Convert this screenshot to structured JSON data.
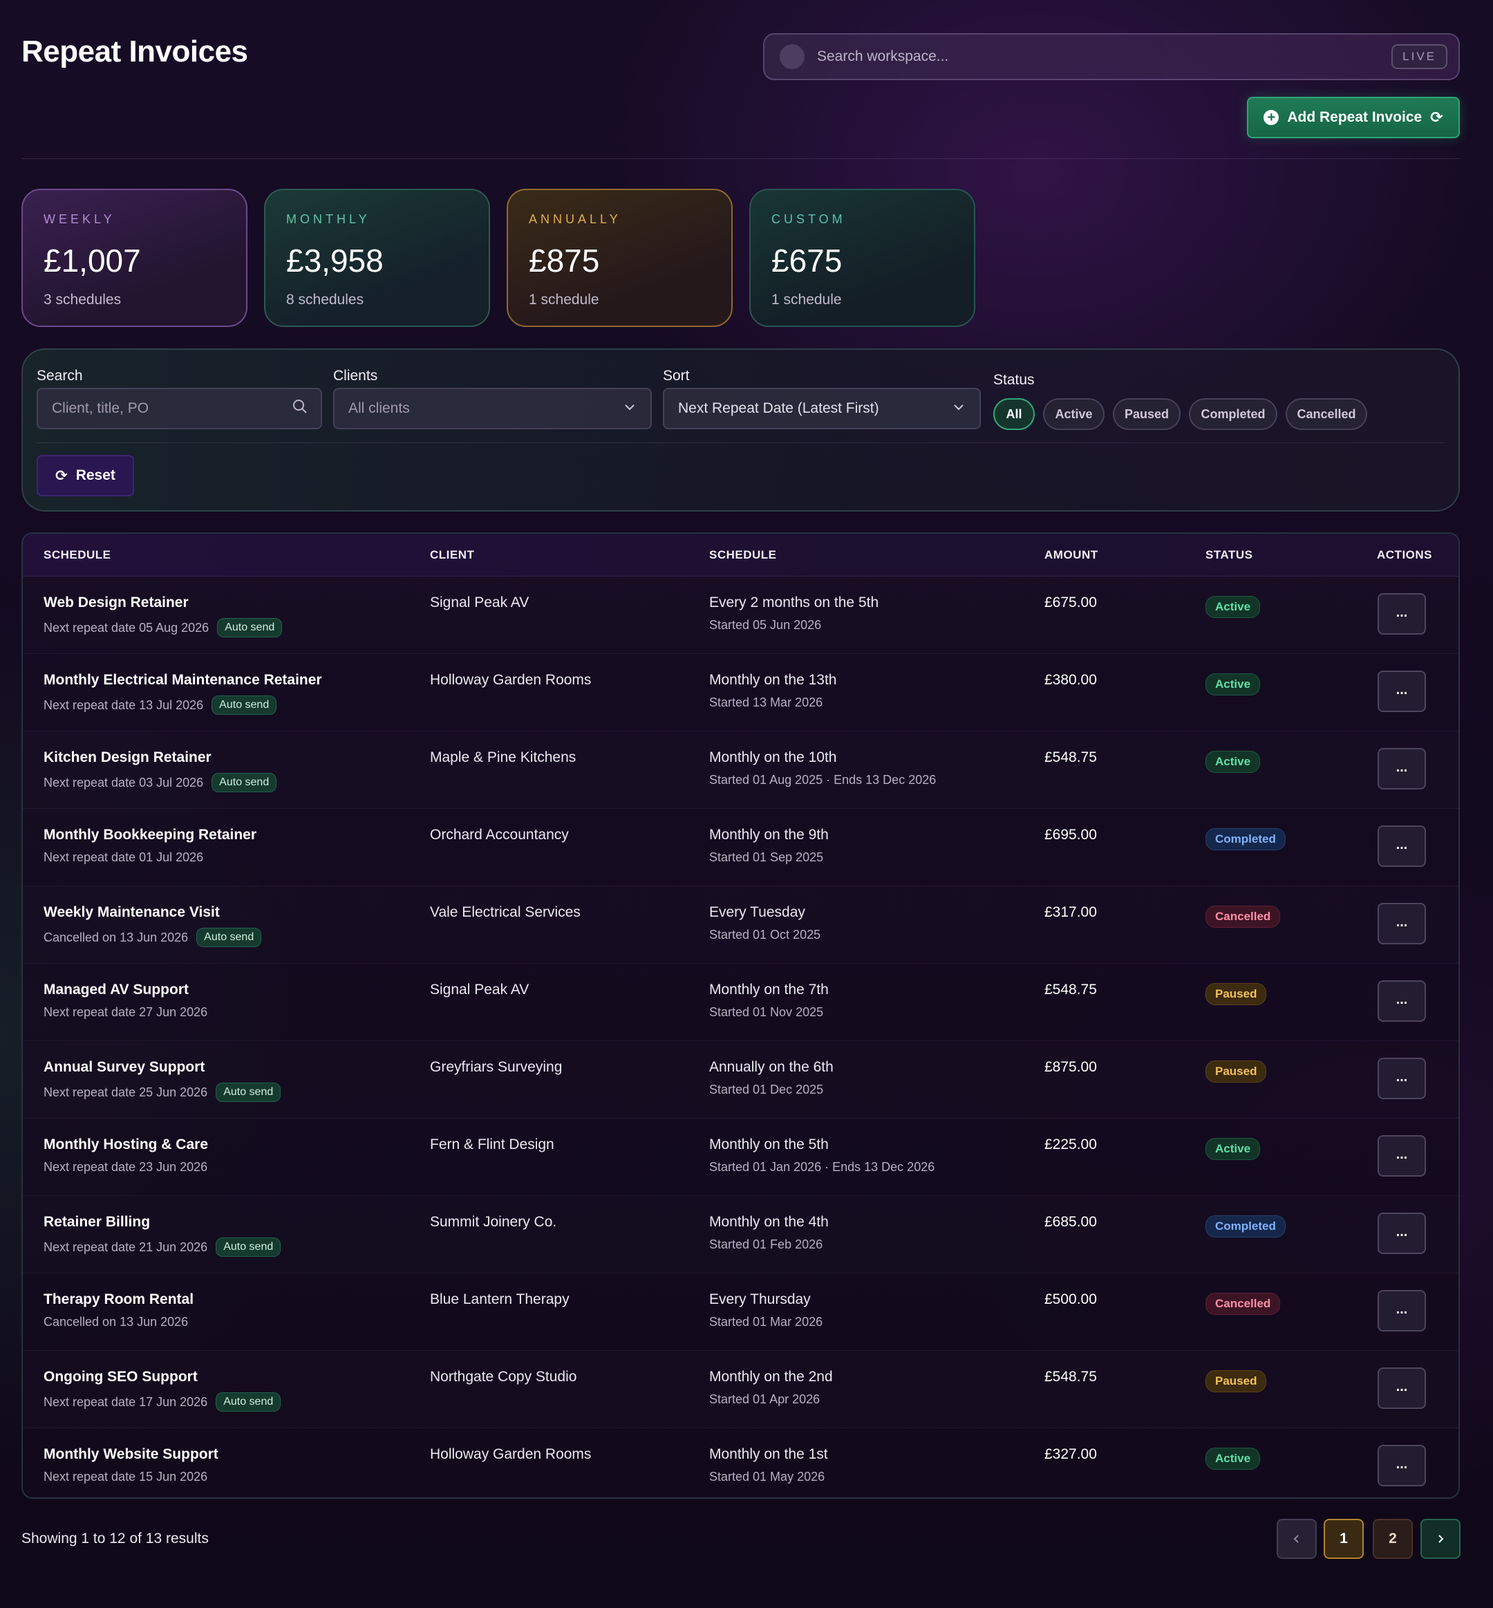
{
  "header": {
    "title": "Repeat Invoices",
    "search_placeholder": "Search workspace...",
    "live_label": "LIVE",
    "add_button_label": "Add Repeat Invoice"
  },
  "stats": [
    {
      "label": "WEEKLY",
      "value": "£1,007",
      "sub": "3 schedules",
      "accent": "#b28ad6"
    },
    {
      "label": "MONTHLY",
      "value": "£3,958",
      "sub": "8 schedules",
      "accent": "#5fc6a2"
    },
    {
      "label": "ANNUALLY",
      "value": "£875",
      "sub": "1 schedule",
      "accent": "#e3ae48"
    },
    {
      "label": "CUSTOM",
      "value": "£675",
      "sub": "1 schedule",
      "accent": "#5bbfb0"
    }
  ],
  "filters": {
    "search_label": "Search",
    "search_placeholder": "Client, title, PO",
    "clients_label": "Clients",
    "clients_value": "All clients",
    "sort_label": "Sort",
    "sort_value": "Next Repeat Date (Latest First)",
    "status_label": "Status",
    "status_options": [
      "All",
      "Active",
      "Paused",
      "Completed",
      "Cancelled"
    ],
    "status_selected": "All",
    "reset_label": "Reset"
  },
  "table": {
    "headers": [
      "SCHEDULE",
      "CLIENT",
      "SCHEDULE",
      "AMOUNT",
      "STATUS",
      "ACTIONS"
    ],
    "action_label": "...",
    "rows": [
      {
        "title": "Web Design Retainer",
        "sub": "Next repeat date 05 Aug 2026",
        "auto": "Auto send",
        "client": "Signal Peak AV",
        "schedule": "Every 2 months on the 5th",
        "started": "Started 05 Jun 2026",
        "amount": "£675.00",
        "status": "Active"
      },
      {
        "title": "Monthly Electrical Maintenance Retainer",
        "sub": "Next repeat date 13 Jul 2026",
        "auto": "Auto send",
        "client": "Holloway Garden Rooms",
        "schedule": "Monthly on the 13th",
        "started": "Started 13 Mar 2026",
        "amount": "£380.00",
        "status": "Active"
      },
      {
        "title": "Kitchen Design Retainer",
        "sub": "Next repeat date 03 Jul 2026",
        "auto": "Auto send",
        "client": "Maple & Pine Kitchens",
        "schedule": "Monthly on the 10th",
        "started": "Started 01 Aug 2025 · Ends 13 Dec 2026",
        "amount": "£548.75",
        "status": "Active"
      },
      {
        "title": "Monthly Bookkeeping Retainer",
        "sub": "Next repeat date 01 Jul 2026",
        "auto": "",
        "client": "Orchard Accountancy",
        "schedule": "Monthly on the 9th",
        "started": "Started 01 Sep 2025",
        "amount": "£695.00",
        "status": "Completed"
      },
      {
        "title": "Weekly Maintenance Visit",
        "sub": "Cancelled on 13 Jun 2026",
        "auto": "Auto send",
        "client": "Vale Electrical Services",
        "schedule": "Every Tuesday",
        "started": "Started 01 Oct 2025",
        "amount": "£317.00",
        "status": "Cancelled"
      },
      {
        "title": "Managed AV Support",
        "sub": "Next repeat date 27 Jun 2026",
        "auto": "",
        "client": "Signal Peak AV",
        "schedule": "Monthly on the 7th",
        "started": "Started 01 Nov 2025",
        "amount": "£548.75",
        "status": "Paused"
      },
      {
        "title": "Annual Survey Support",
        "sub": "Next repeat date 25 Jun 2026",
        "auto": "Auto send",
        "client": "Greyfriars Surveying",
        "schedule": "Annually on the 6th",
        "started": "Started 01 Dec 2025",
        "amount": "£875.00",
        "status": "Paused"
      },
      {
        "title": "Monthly Hosting & Care",
        "sub": "Next repeat date 23 Jun 2026",
        "auto": "",
        "client": "Fern & Flint Design",
        "schedule": "Monthly on the 5th",
        "started": "Started 01 Jan 2026 · Ends 13 Dec 2026",
        "amount": "£225.00",
        "status": "Active"
      },
      {
        "title": "Retainer Billing",
        "sub": "Next repeat date 21 Jun 2026",
        "auto": "Auto send",
        "client": "Summit Joinery Co.",
        "schedule": "Monthly on the 4th",
        "started": "Started 01 Feb 2026",
        "amount": "£685.00",
        "status": "Completed"
      },
      {
        "title": "Therapy Room Rental",
        "sub": "Cancelled on 13 Jun 2026",
        "auto": "",
        "client": "Blue Lantern Therapy",
        "schedule": "Every Thursday",
        "started": "Started 01 Mar 2026",
        "amount": "£500.00",
        "status": "Cancelled"
      },
      {
        "title": "Ongoing SEO Support",
        "sub": "Next repeat date 17 Jun 2026",
        "auto": "Auto send",
        "client": "Northgate Copy Studio",
        "schedule": "Monthly on the 2nd",
        "started": "Started 01 Apr 2026",
        "amount": "£548.75",
        "status": "Paused"
      },
      {
        "title": "Monthly Website Support",
        "sub": "Next repeat date 15 Jun 2026",
        "auto": "",
        "client": "Holloway Garden Rooms",
        "schedule": "Monthly on the 1st",
        "started": "Started 01 May 2026",
        "amount": "£327.00",
        "status": "Active"
      }
    ]
  },
  "pagination": {
    "showing_text": "Showing 1 to 12 of 13 results",
    "pages": [
      "1",
      "2"
    ],
    "current_page": "1"
  },
  "colors": {
    "active": "#5fe0a8",
    "completed": "#7fb2ff",
    "cancelled": "#ff8fa8",
    "paused": "#f3c15a",
    "primary_button": "#1f7a55"
  }
}
